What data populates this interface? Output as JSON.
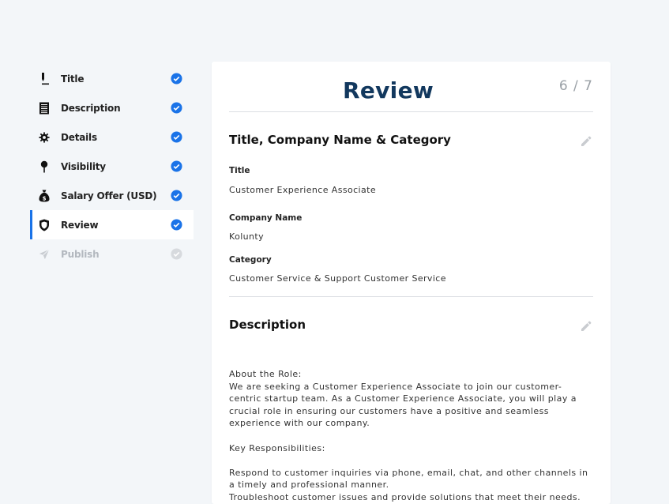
{
  "sidebar": {
    "steps": [
      {
        "label": "Title",
        "icon": "pen-icon",
        "state": "done"
      },
      {
        "label": "Description",
        "icon": "document-icon",
        "state": "done"
      },
      {
        "label": "Details",
        "icon": "gear-icon",
        "state": "done"
      },
      {
        "label": "Visibility",
        "icon": "pin-icon",
        "state": "done"
      },
      {
        "label": "Salary Offer (USD)",
        "icon": "money-bag-icon",
        "state": "done"
      },
      {
        "label": "Review",
        "icon": "shield-icon",
        "state": "active"
      },
      {
        "label": "Publish",
        "icon": "send-icon",
        "state": "disabled"
      }
    ]
  },
  "colors": {
    "accent": "#1a73e8",
    "title": "#12385e",
    "disabled": "#b3b8bf"
  },
  "card": {
    "title": "Review",
    "step_count": "6 / 7",
    "section1": {
      "title": "Title, Company Name & Category",
      "fields": [
        {
          "label": "Title",
          "value": "Customer Experience Associate"
        },
        {
          "label": "Company Name",
          "value": "Kolunty"
        },
        {
          "label": "Category",
          "value": "Customer Service & Support Customer Service"
        }
      ]
    },
    "section2": {
      "title": "Description",
      "body": "About the Role:\nWe are seeking a Customer Experience Associate to join our customer-centric startup team. As a Customer Experience Associate, you will play a crucial role in ensuring our customers have a positive and seamless experience with our company.\n\nKey Responsibilities:\n\nRespond to customer inquiries via phone, email, chat, and other channels in a timely and professional manner.\nTroubleshoot customer issues and provide solutions that meet their needs."
    }
  }
}
